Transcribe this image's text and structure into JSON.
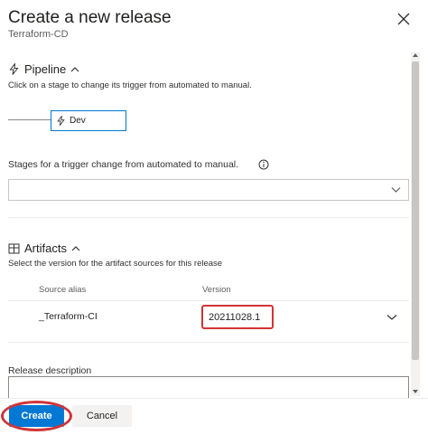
{
  "dialog": {
    "title": "Create a new release",
    "subtitle": "Terraform-CD"
  },
  "pipeline": {
    "heading": "Pipeline",
    "description": "Click on a stage to change its trigger from automated to manual.",
    "stage_name": "Dev"
  },
  "trigger": {
    "label": "Stages for a trigger change from automated to manual.",
    "selected_value": ""
  },
  "artifacts": {
    "heading": "Artifacts",
    "description": "Select the version for the artifact sources for this release",
    "columns": [
      "Source alias",
      "Version"
    ],
    "rows": [
      {
        "source_alias": "_Terraform-CI",
        "version": "20211028.1"
      }
    ]
  },
  "release": {
    "description_label": "Release description",
    "description_value": ""
  },
  "footer": {
    "create_label": "Create",
    "cancel_label": "Cancel"
  },
  "colors": {
    "primary": "#0078d4",
    "highlight": "#d13438"
  },
  "icons": {
    "close": "close-icon",
    "pipeline": "lightning-icon",
    "artifacts": "package-icon",
    "info": "info-icon",
    "chevron": "chevron-down-icon"
  }
}
